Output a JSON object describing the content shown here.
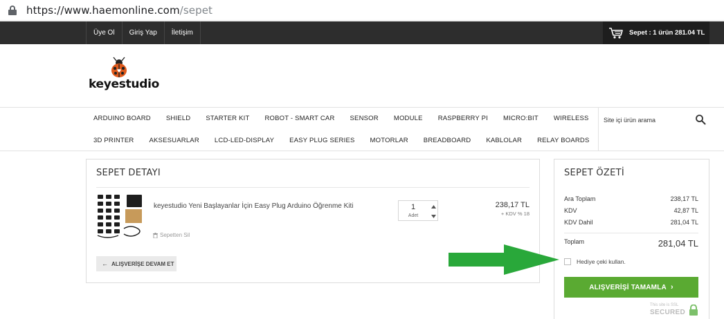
{
  "browser": {
    "url_host": "https://www.haemonline.com",
    "url_path": "/sepet"
  },
  "topbar": {
    "links": [
      "Üye Ol",
      "Giriş Yap",
      "İletişim"
    ],
    "cart_summary": "Sepet : 1 ürün 281.04 TL"
  },
  "logo": {
    "brand": "keyestudio"
  },
  "nav": {
    "row1": [
      "ARDUINO BOARD",
      "SHIELD",
      "STARTER KIT",
      "ROBOT - SMART CAR",
      "SENSOR",
      "MODULE",
      "RASPBERRY PI",
      "MICRO:BIT",
      "WIRELESS"
    ],
    "row2": [
      "3D PRINTER",
      "AKSESUARLAR",
      "LCD-LED-DISPLAY",
      "EASY PLUG SERIES",
      "MOTORLAR",
      "BREADBOARD",
      "KABLOLAR",
      "RELAY BOARDS"
    ],
    "search_placeholder": "Site içi ürün arama"
  },
  "detail": {
    "title": "SEPET DETAYI",
    "item": {
      "name": "keyestudio Yeni Başlayanlar İçin Easy Plug Arduino Öğrenme Kiti",
      "remove_label": "Sepetten Sil",
      "quantity": "1",
      "quantity_unit": "Adet",
      "price": "238,17 TL",
      "tax_note": "+ KDV % 18"
    },
    "continue_label": "ALIŞVERİŞE DEVAM ET"
  },
  "summary": {
    "title": "SEPET ÖZETİ",
    "rows": [
      {
        "label": "Ara Toplam",
        "value": "238,17 TL"
      },
      {
        "label": "KDV",
        "value": "42,87 TL"
      },
      {
        "label": "KDV Dahil",
        "value": "281,04 TL"
      }
    ],
    "total_label": "Toplam",
    "total_value": "281,04 TL",
    "gift_label": "Hediye çeki kullan.",
    "checkout_label": "ALIŞVERİŞİ TAMAMLA",
    "ssl_small": "This site is SSL",
    "ssl_big": "SECURED"
  },
  "colors": {
    "topbar": "#2d2d2d",
    "checkout_green": "#5aaa32",
    "annotation_arrow": "#29a83a"
  }
}
